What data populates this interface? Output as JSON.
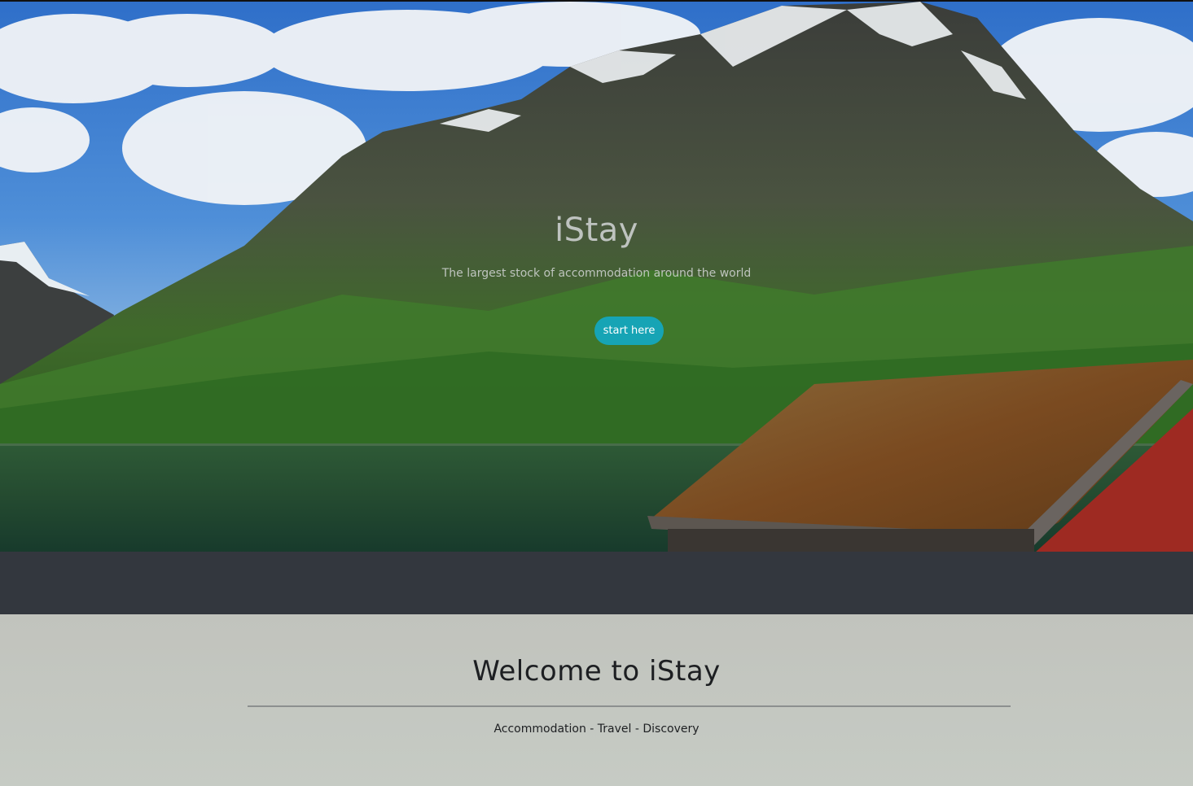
{
  "hero": {
    "title": "iStay",
    "subtitle": "The largest stock of accommodation around the world",
    "cta_label": "start here"
  },
  "welcome": {
    "title": "Welcome to iStay",
    "tagline": "Accommodation - Travel - Discovery"
  },
  "colors": {
    "accent": "#16a4b5",
    "dark_band": "#33373e",
    "section_bg": "#c4c8c1",
    "text_dark": "#1d1f22"
  }
}
